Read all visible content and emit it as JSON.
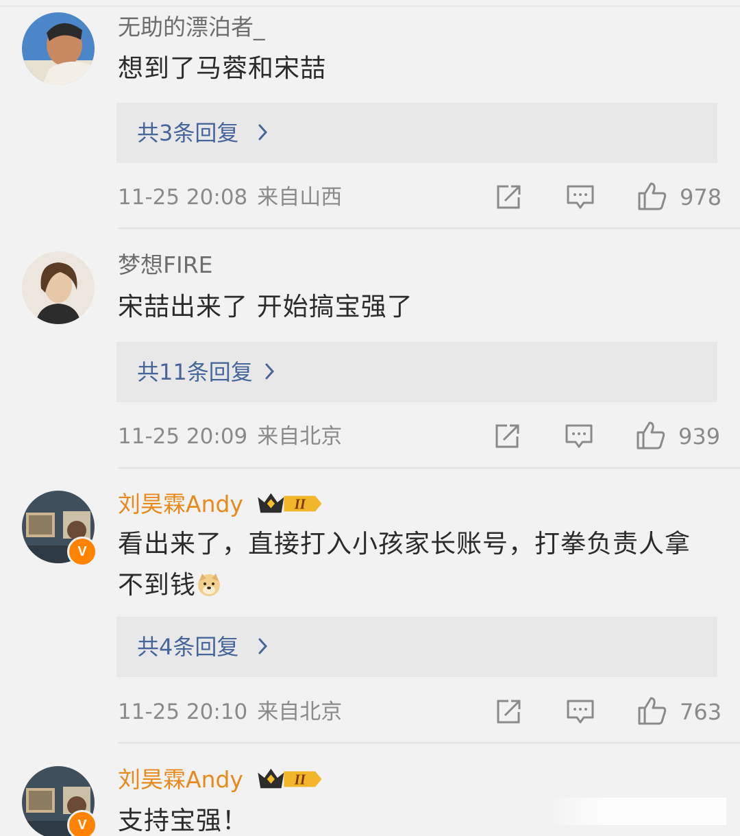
{
  "comments": [
    {
      "username": "无助的漂泊者_",
      "text": "想到了马蓉和宋喆",
      "replies_label": "共3条回复",
      "timestamp": "11-25 20:08",
      "location": "来自山西",
      "likes": "978"
    },
    {
      "username": "梦想FIRE",
      "text": "宋喆出来了 开始搞宝强了",
      "replies_label": "共11条回复",
      "timestamp": "11-25 20:09",
      "location": "来自北京",
      "likes": "939"
    },
    {
      "username": "刘昊霖Andy",
      "text": "看出来了，直接打入小孩家长账号，打拳负责人拿不到钱",
      "replies_label": "共4条回复",
      "timestamp": "11-25 20:10",
      "location": "来自北京",
      "likes": "763"
    },
    {
      "username": "刘昊霖Andy",
      "text": "支持宝强！"
    }
  ],
  "badges": {
    "verified": "V",
    "vip_level": "II"
  },
  "colors": {
    "background": "#f2f2f2",
    "replies_box": "#e8e8e8",
    "link_blue": "#46659a",
    "vip_name": "#e8891c",
    "verified_orange": "#ff8200",
    "meta_gray": "#8a8a8a"
  },
  "icons": [
    "share-icon",
    "comment-icon",
    "like-icon",
    "chevron-right-icon",
    "crown-vip-icon",
    "doge-emoji"
  ]
}
